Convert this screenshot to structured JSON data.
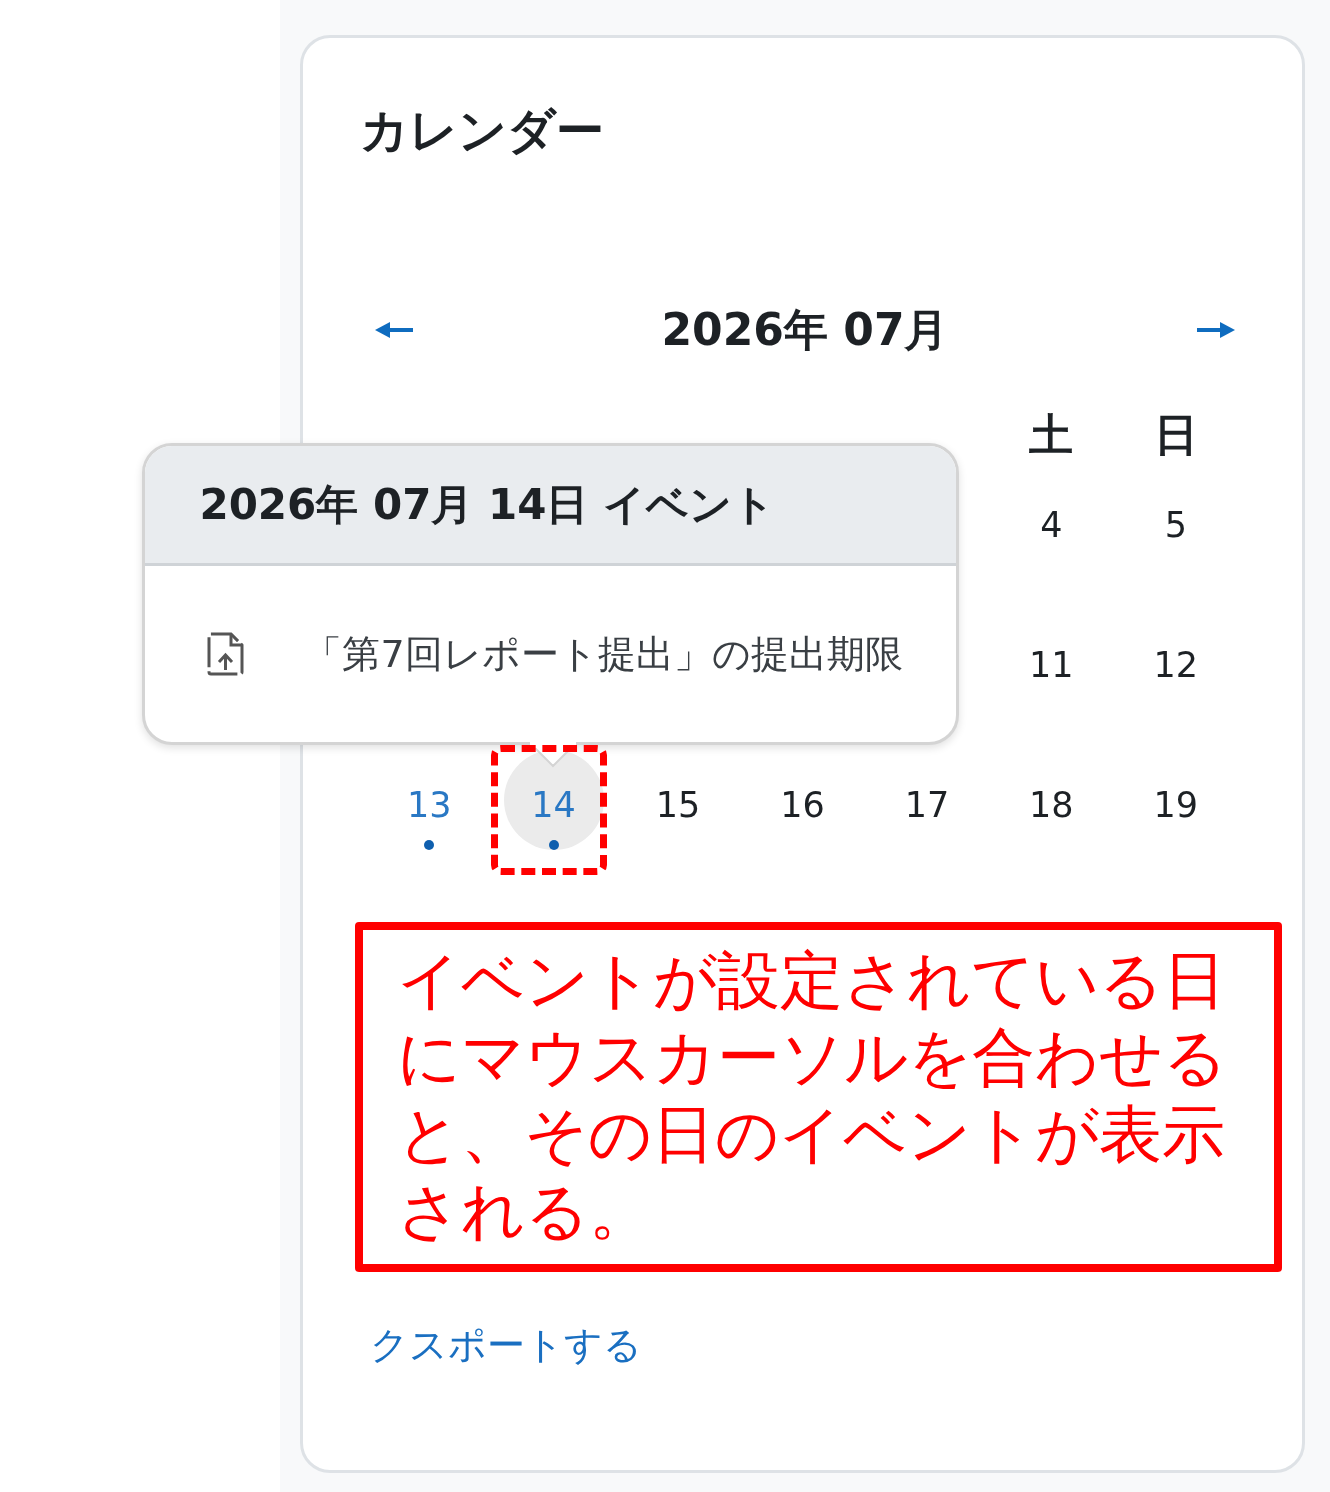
{
  "block": {
    "title": "カレンダー"
  },
  "calendar": {
    "month_title": "2026年 07月",
    "weekdays": [
      "土",
      "日"
    ],
    "weeks": [
      {
        "days": [
          {
            "day": "4",
            "has_event": false,
            "hovered": false,
            "marked": false
          },
          {
            "day": "5",
            "has_event": false,
            "hovered": false,
            "marked": false
          }
        ]
      },
      {
        "days": [
          {
            "day": "11",
            "has_event": false,
            "hovered": false,
            "marked": false
          },
          {
            "day": "12",
            "has_event": false,
            "hovered": false,
            "marked": false
          }
        ]
      },
      {
        "days": [
          {
            "day": "13",
            "has_event": true,
            "hovered": false,
            "marked": false
          },
          {
            "day": "14",
            "has_event": true,
            "hovered": true,
            "marked": true
          },
          {
            "day": "15",
            "has_event": false,
            "hovered": false,
            "marked": false
          },
          {
            "day": "16",
            "has_event": false,
            "hovered": false,
            "marked": false
          },
          {
            "day": "17",
            "has_event": false,
            "hovered": false,
            "marked": false
          },
          {
            "day": "18",
            "has_event": false,
            "hovered": false,
            "marked": false
          },
          {
            "day": "19",
            "has_event": false,
            "hovered": false,
            "marked": false
          }
        ]
      }
    ],
    "popover": {
      "title": "2026年 07月 14日 イベント",
      "events": [
        {
          "kind": "assignment",
          "name": "「第7回レポート提出」の提出期限"
        }
      ]
    }
  },
  "footer_links": [
    {
      "text": "クスポートする"
    }
  ],
  "annotation": {
    "text": "イベントが設定されている日にマウスカーソルを合わせると、その日のイベントが表示される。"
  }
}
